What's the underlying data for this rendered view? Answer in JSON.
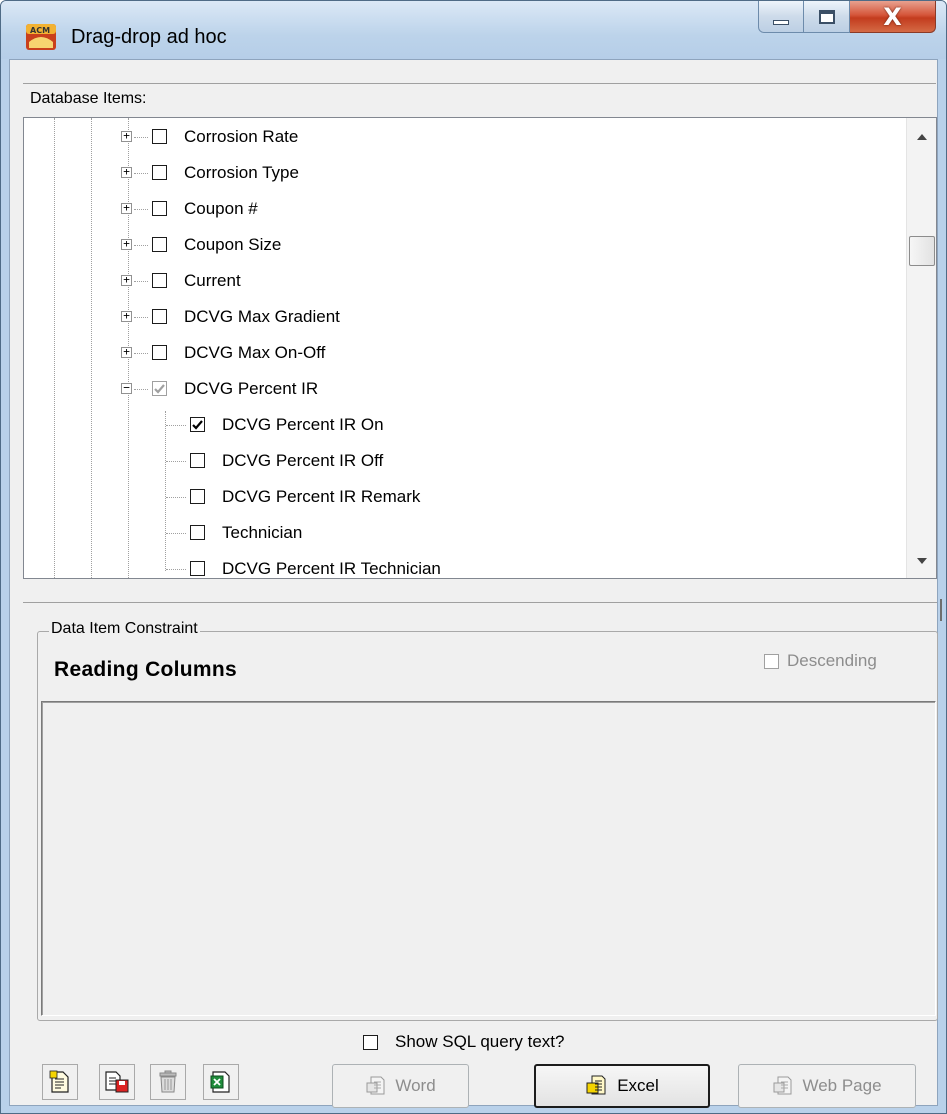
{
  "window": {
    "title": "Drag-drop ad hoc",
    "minimize_glyph": "minimize-icon",
    "maximize_glyph": "maximize-icon",
    "close_glyph": "X"
  },
  "database_items": {
    "label": "Database Items:",
    "tree": [
      {
        "label": "Corrosion Rate",
        "checked": false,
        "expander": "+",
        "level": 1
      },
      {
        "label": "Corrosion Type",
        "checked": false,
        "expander": "+",
        "level": 1
      },
      {
        "label": "Coupon #",
        "checked": false,
        "expander": "+",
        "level": 1
      },
      {
        "label": "Coupon Size",
        "checked": false,
        "expander": "+",
        "level": 1
      },
      {
        "label": "Current",
        "checked": false,
        "expander": "+",
        "level": 1
      },
      {
        "label": "DCVG Max Gradient",
        "checked": false,
        "expander": "+",
        "level": 1
      },
      {
        "label": "DCVG Max On-Off",
        "checked": false,
        "expander": "+",
        "level": 1
      },
      {
        "label": "DCVG Percent IR",
        "checked": "partial",
        "expander": "-",
        "level": 1
      },
      {
        "label": "DCVG Percent IR On",
        "checked": true,
        "level": 2
      },
      {
        "label": "DCVG Percent IR Off",
        "checked": false,
        "level": 2
      },
      {
        "label": "DCVG Percent IR Remark",
        "checked": false,
        "level": 2
      },
      {
        "label": "Technician",
        "checked": false,
        "level": 2
      },
      {
        "label": "DCVG Percent IR Technician",
        "checked": false,
        "level": 2
      }
    ]
  },
  "constraint": {
    "group_label": "Data Item Constraint",
    "title": "Reading Columns",
    "descending_label": "Descending",
    "descending_checked": false
  },
  "bottom": {
    "show_sql_label": "Show SQL query text?",
    "show_sql_checked": false,
    "tool_buttons": [
      "new-query-icon",
      "save-query-icon",
      "delete-icon",
      "export-excel-icon"
    ],
    "word_label": "Word",
    "excel_label": "Excel",
    "webpage_label": "Web Page"
  },
  "colors": {
    "title_bar": "#bcd3ea",
    "close_button": "#c33c1e",
    "panel": "#f0f0f0"
  }
}
